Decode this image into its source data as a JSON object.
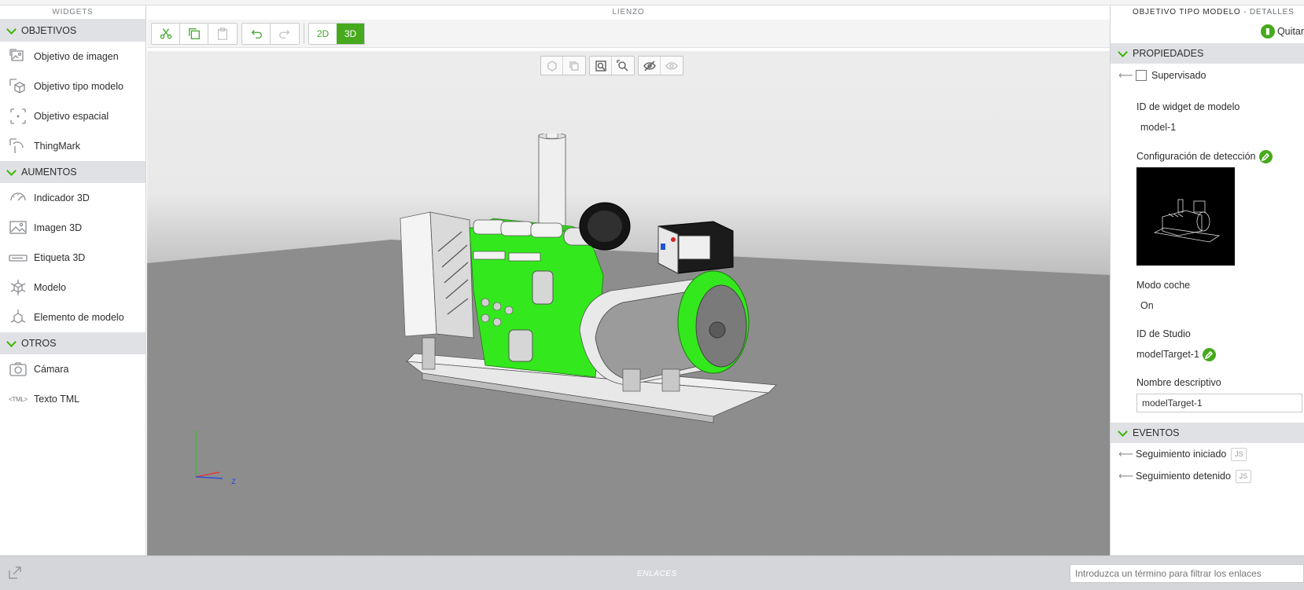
{
  "left_panel": {
    "title": "WIDGETS",
    "sections": [
      {
        "label": "OBJETIVOS",
        "items": [
          "Objetivo de imagen",
          "Objetivo tipo modelo",
          "Objetivo espacial",
          "ThingMark"
        ]
      },
      {
        "label": "AUMENTOS",
        "items": [
          "Indicador 3D",
          "Imagen 3D",
          "Etiqueta 3D",
          "Modelo",
          "Elemento de modelo"
        ]
      },
      {
        "label": "OTROS",
        "items": [
          "Cámara",
          "Texto TML"
        ]
      }
    ],
    "tml_icon_text": "<TML>"
  },
  "canvas": {
    "title": "LIENZO",
    "mode_2d": "2D",
    "mode_3d": "3D",
    "active_mode": "3D",
    "axis_y": "y",
    "axis_z": "z"
  },
  "details": {
    "title": "OBJETIVO TIPO MODELO",
    "subtitle": "- DETALLES",
    "remove_label": "Quitar",
    "properties_label": "PROPIEDADES",
    "supervised_label": "Supervisado",
    "supervised_checked": false,
    "model_widget_id_label": "ID de widget de modelo",
    "model_widget_id_value": "model-1",
    "detection_config_label": "Configuración de detección",
    "car_mode_label": "Modo coche",
    "car_mode_value": "On",
    "studio_id_label": "ID de Studio",
    "studio_id_value": "modelTarget-1",
    "friendly_name_label": "Nombre descriptivo",
    "friendly_name_value": "modelTarget-1",
    "events_label": "EVENTOS",
    "events": [
      "Seguimiento iniciado",
      "Seguimiento detenido"
    ],
    "js_label": "JS"
  },
  "bindings_bar": {
    "title": "ENLACES",
    "filter_placeholder": "Introduzca un término para filtrar los enlaces"
  },
  "colors": {
    "accent": "#47a91e",
    "highlight_green": "#33e81c",
    "section_bg": "#dfe1e4"
  }
}
